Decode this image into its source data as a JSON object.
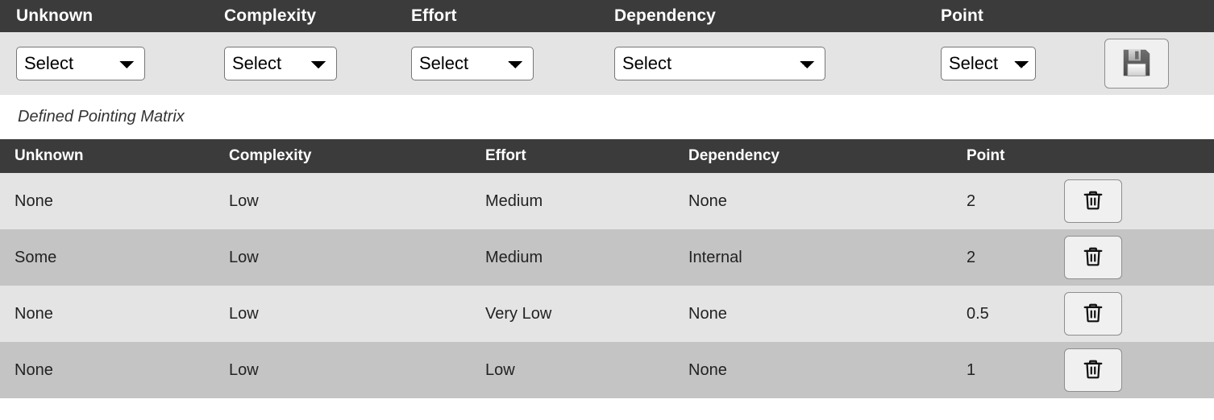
{
  "entry_form": {
    "columns": [
      {
        "label": "Unknown",
        "icon": "chevron-down-icon"
      },
      {
        "label": "Complexity",
        "icon": "chevron-down-icon"
      },
      {
        "label": "Effort",
        "icon": "chevron-down-icon"
      },
      {
        "label": "Dependency",
        "icon": "chevron-down-icon"
      },
      {
        "label": "Point",
        "icon": "chevron-down-icon"
      }
    ],
    "selects": [
      {
        "name": "unknown-select",
        "value": "Select",
        "options": [
          "Select"
        ]
      },
      {
        "name": "complexity-select",
        "value": "Select",
        "options": [
          "Select"
        ]
      },
      {
        "name": "effort-select",
        "value": "Select",
        "options": [
          "Select"
        ]
      },
      {
        "name": "dependency-select",
        "value": "Select",
        "options": [
          "Select"
        ]
      },
      {
        "name": "point-select",
        "value": "Select",
        "options": [
          "Select"
        ]
      }
    ],
    "save_button": {
      "icon": "save-floppy-disk-icon",
      "title": "Save"
    }
  },
  "matrix": {
    "caption": "Defined Pointing Matrix",
    "headers": [
      "Unknown",
      "Complexity",
      "Effort",
      "Dependency",
      "Point"
    ],
    "rows": [
      {
        "unknown": "None",
        "complexity": "Low",
        "effort": "Medium",
        "dependency": "None",
        "point": "2",
        "delete_icon": "trash-can-icon"
      },
      {
        "unknown": "Some",
        "complexity": "Low",
        "effort": "Medium",
        "dependency": "Internal",
        "point": "2",
        "delete_icon": "trash-can-icon"
      },
      {
        "unknown": "None",
        "complexity": "Low",
        "effort": "Very Low",
        "dependency": "None",
        "point": "0.5",
        "delete_icon": "trash-can-icon"
      },
      {
        "unknown": "None",
        "complexity": "Low",
        "effort": "Low",
        "dependency": "None",
        "point": "1",
        "delete_icon": "trash-can-icon"
      }
    ]
  },
  "colors": {
    "header_bar": "#3b3b3b",
    "form_background": "#e4e4e4",
    "row_odd": "#e4e4e4",
    "row_even": "#c4c4c4",
    "page_background": "#ffffff",
    "header_text": "#ffffff",
    "body_text": "#222222"
  }
}
